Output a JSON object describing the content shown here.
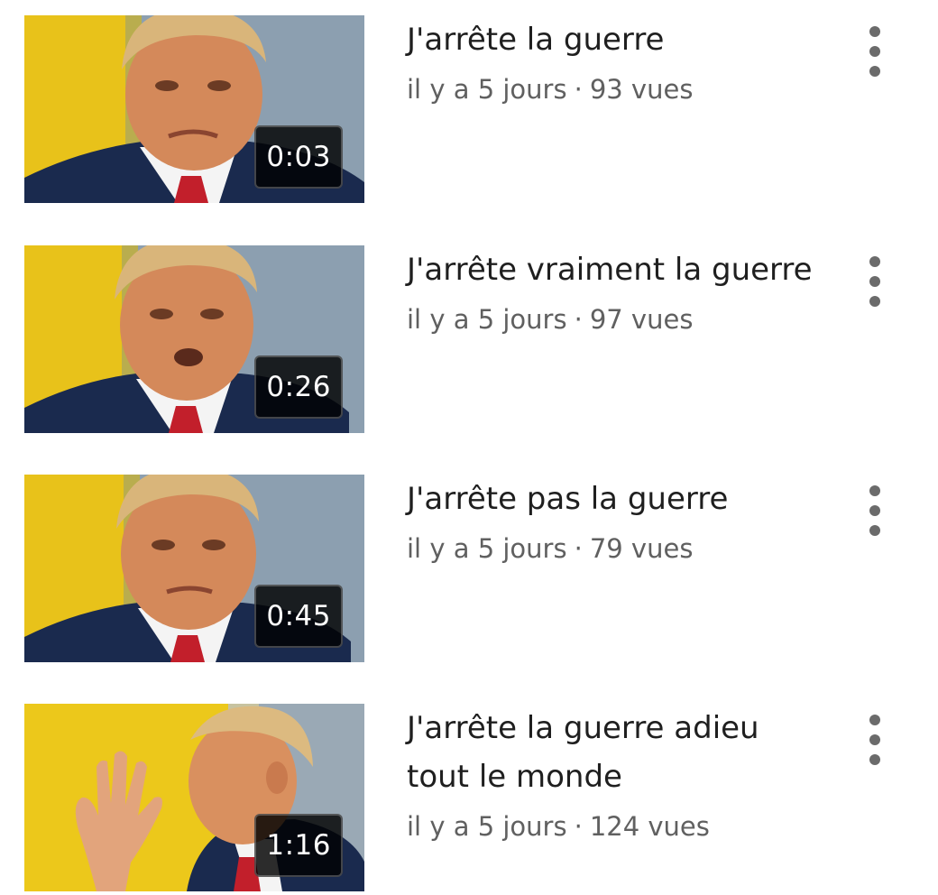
{
  "videos": [
    {
      "title": "J'arrête la guerre",
      "age": "il y a 5 jours",
      "separator": "·",
      "views": "93 vues",
      "duration": "0:03",
      "icon": "more-vert-icon",
      "colors": {
        "left_bg": "#e8c21a",
        "right_bg": "#8c9fb0",
        "suit": "#1a2a4e",
        "tie": "#c21f2b",
        "skin": "#d4895a",
        "hair": "#d9b57a"
      }
    },
    {
      "title": "J'arrête vraiment la guerre",
      "age": "il y a 5 jours",
      "separator": "·",
      "views": "97 vues",
      "duration": "0:26",
      "icon": "more-vert-icon",
      "colors": {
        "left_bg": "#e8c21a",
        "right_bg": "#8c9fb0",
        "suit": "#1a2a4e",
        "tie": "#c21f2b",
        "skin": "#d4895a",
        "hair": "#d9b57a"
      }
    },
    {
      "title": "J'arrête pas la guerre",
      "age": "il y a 5 jours",
      "separator": "·",
      "views": "79 vues",
      "duration": "0:45",
      "icon": "more-vert-icon",
      "colors": {
        "left_bg": "#e8c21a",
        "right_bg": "#8c9fb0",
        "suit": "#1a2a4e",
        "tie": "#c21f2b",
        "skin": "#d4895a",
        "hair": "#d9b57a"
      }
    },
    {
      "title": "J'arrête la guerre adieu tout le monde",
      "age": "il y a 5 jours",
      "separator": "·",
      "views": "124 vues",
      "duration": "1:16",
      "icon": "more-vert-icon",
      "colors": {
        "left_bg": "#ecc81b",
        "right_bg": "#9aa9b5",
        "suit": "#1a2a4e",
        "tie": "#c21f2b",
        "skin": "#d9905f",
        "hair": "#dcba80"
      }
    }
  ]
}
